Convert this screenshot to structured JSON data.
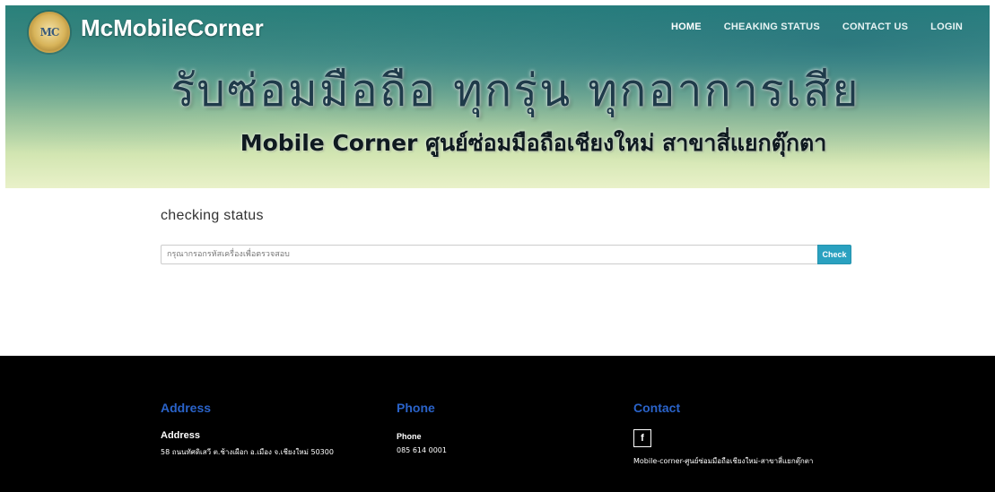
{
  "header": {
    "logo_text": "MC",
    "brand": "McMobileCorner",
    "nav": [
      {
        "label": "HOME"
      },
      {
        "label": "CHEAKING STATUS"
      },
      {
        "label": "CONTACT US"
      },
      {
        "label": "LOGIN"
      }
    ],
    "banner_line1": "รับซ่อมมือถือ ทุกรุ่น ทุกอาการเสีย",
    "banner_line2": "Mobile Corner ศูนย์ซ่อมมือถือเชียงใหม่ สาขาสี่แยกตุ๊กตา"
  },
  "main": {
    "title": "checking status",
    "search_placeholder": "กรุณากรอกรหัสเครื่องเพื่อตรวจสอบ",
    "check_label": "Check"
  },
  "footer": {
    "address": {
      "heading": "Address",
      "sub": "Address",
      "text": "58 ถนนทัศดิเสวี ต.ช้างเผือก อ.เมือง จ.เชียงใหม่ 50300"
    },
    "phone": {
      "heading": "Phone",
      "sub": "Phone",
      "text": "085 614 0001"
    },
    "contact": {
      "heading": "Contact",
      "icon_label": "f",
      "text": "Mobile-corner-ศูนย์ซ่อมมือถือเชียงใหม่-สาขาสี่แยกตุ๊กตา"
    }
  },
  "colors": {
    "accent": "#2aa1c0",
    "footer_heading": "#2a63c9",
    "footer_bg": "#000000"
  }
}
